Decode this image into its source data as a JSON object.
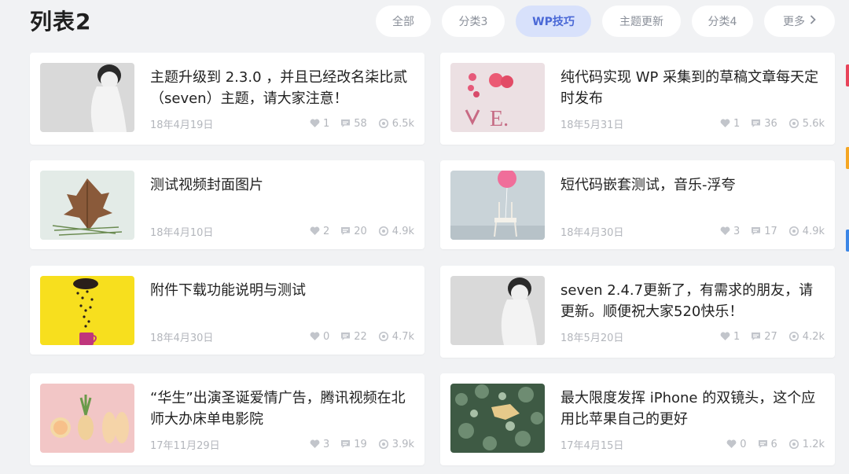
{
  "header": {
    "title": "列表2",
    "tabs": [
      {
        "label": "全部",
        "active": false
      },
      {
        "label": "分类3",
        "active": false
      },
      {
        "label": "WP技巧",
        "active": true
      },
      {
        "label": "主题更新",
        "active": false
      },
      {
        "label": "分类4",
        "active": false
      },
      {
        "label": "更多",
        "active": false
      }
    ]
  },
  "icons": {
    "like": "heart-icon",
    "comments": "comment-icon",
    "views": "eye-icon",
    "more": "chevron-right-icon"
  },
  "colors": {
    "accent": "#4a68d6",
    "active_tab_bg": "#d8e1fb",
    "meta_text": "#b3b6bc",
    "edge_marks": [
      "#e8445a",
      "#f5a623",
      "#3b86e6"
    ]
  },
  "posts": [
    {
      "title": "主题升级到 2.3.0 ，并且已经改名柒比贰（seven）主题，请大家注意！",
      "date": "18年4月19日",
      "likes": "1",
      "comments": "58",
      "views": "6.5k",
      "thumb": "woman-bw"
    },
    {
      "title": "纯代码实现 WP 采集到的草稿文章每天定时发布",
      "date": "18年5月31日",
      "likes": "1",
      "comments": "36",
      "views": "5.6k",
      "thumb": "love-flowers"
    },
    {
      "title": "测试视频封面图片",
      "date": "18年4月10日",
      "likes": "2",
      "comments": "20",
      "views": "4.9k",
      "thumb": "leaf"
    },
    {
      "title": "短代码嵌套测试，音乐-浮夸",
      "date": "18年4月30日",
      "likes": "3",
      "comments": "17",
      "views": "4.9k",
      "thumb": "balloon-chair"
    },
    {
      "title": "附件下载功能说明与测试",
      "date": "18年4月30日",
      "likes": "0",
      "comments": "22",
      "views": "4.7k",
      "thumb": "cup-yellow"
    },
    {
      "title": "seven 2.4.7更新了，有需求的朋友，请更新。顺便祝大家520快乐！",
      "date": "18年5月20日",
      "likes": "1",
      "comments": "27",
      "views": "4.2k",
      "thumb": "woman-bw"
    },
    {
      "title": "“华生”出演圣诞爱情广告，腾讯视频在北师大办床单电影院",
      "date": "17年11月29日",
      "likes": "3",
      "comments": "19",
      "views": "3.9k",
      "thumb": "pineapple-shoes"
    },
    {
      "title": "最大限度发挥 iPhone 的双镜头，这个应用比苹果自己的更好",
      "date": "17年4月15日",
      "likes": "0",
      "comments": "6",
      "views": "1.2k",
      "thumb": "leaves-plants"
    }
  ]
}
